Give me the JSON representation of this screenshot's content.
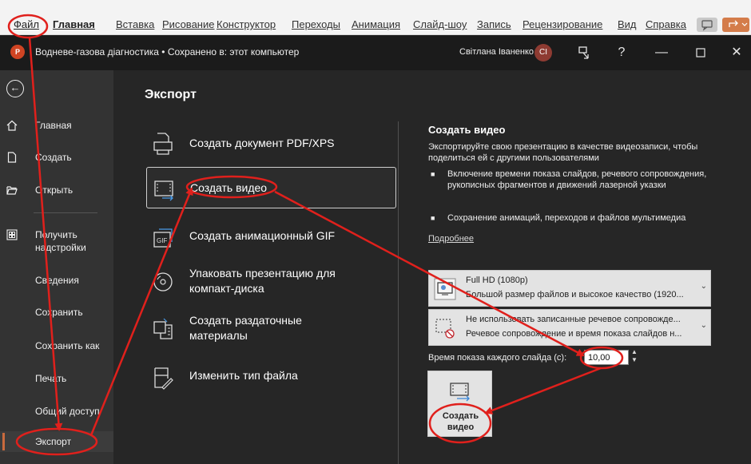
{
  "ribbon": {
    "tabs": [
      {
        "label": "Файл",
        "type": "file"
      },
      {
        "label": "Главная",
        "type": "active"
      },
      {
        "label": "Вставка"
      },
      {
        "label": "Рисование"
      },
      {
        "label": "Конструктор"
      },
      {
        "label": "Переходы"
      },
      {
        "label": "Анимация"
      },
      {
        "label": "Слайд-шоу"
      },
      {
        "label": "Запись"
      },
      {
        "label": "Рецензирование"
      },
      {
        "label": "Вид"
      },
      {
        "label": "Справка"
      }
    ]
  },
  "titlebar": {
    "app_icon_letter": "P",
    "document_title": "Водневе-газова діагностика • Сохранено в: этот компьютер",
    "user_name": "Світлана Іваненко",
    "user_initials": "CI"
  },
  "nav": {
    "back_icon": "back-arrow-icon",
    "items": [
      {
        "label": "Главная",
        "icon": "home-icon"
      },
      {
        "label": "Создать",
        "icon": "new-file-icon"
      },
      {
        "label": "Открыть",
        "icon": "folder-open-icon"
      },
      {
        "label": "Получить\nнадстройки",
        "icon": "addins-icon"
      },
      {
        "label": "Сведения"
      },
      {
        "label": "Сохранить"
      },
      {
        "label": "Сохранить как"
      },
      {
        "label": "Печать"
      },
      {
        "label": "Общий доступ"
      },
      {
        "label": "Экспорт",
        "selected": true
      }
    ]
  },
  "main": {
    "title": "Экспорт",
    "options": [
      {
        "label": "Создать документ PDF/XPS",
        "icon": "pdf-xps-icon"
      },
      {
        "label": "Создать видео",
        "icon": "video-icon",
        "selected": true
      },
      {
        "label": "Создать анимационный GIF",
        "icon": "gif-icon"
      },
      {
        "label": "Упаковать презентацию для\nкомпакт-диска",
        "icon": "cd-icon"
      },
      {
        "label": "Создать раздаточные\nматериалы",
        "icon": "handouts-icon"
      },
      {
        "label": "Изменить тип файла",
        "icon": "change-filetype-icon"
      }
    ]
  },
  "detail": {
    "title": "Создать видео",
    "description": "Экспортируйте свою презентацию в качестве видеозаписи, чтобы поделиться ей с другими пользователями",
    "bullets": [
      "Включение времени показа слайдов, речевого сопровождения, рукописных фрагментов и движений лазерной указки",
      "Сохранение анимаций, переходов и файлов мультимедиа"
    ],
    "learn_more": "Подробнее",
    "quality_dropdown": {
      "title": "Full HD (1080p)",
      "subtitle": "Большой размер файлов и высокое качество (1920..."
    },
    "narration_dropdown": {
      "title": "Не использовать записанные речевое сопровожде...",
      "subtitle": "Речевое сопровождение и время показа слайдов н..."
    },
    "duration_label": "Время показа каждого слайда (с):",
    "duration_value": "10,00",
    "create_button": "Создать\nвидео"
  },
  "colors": {
    "annotation": "#e0201c",
    "accent": "#c96a3d"
  }
}
